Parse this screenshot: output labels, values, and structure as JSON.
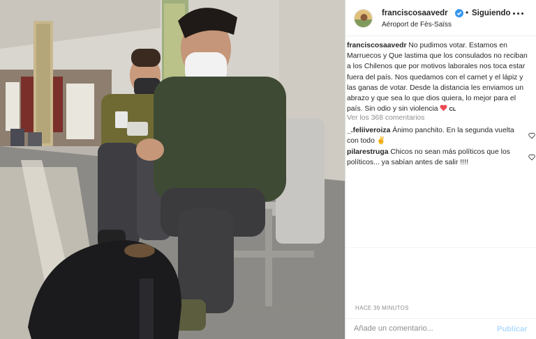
{
  "post": {
    "username": "franciscosaavedr",
    "follow_status": "Siguiendo",
    "separator": "•",
    "location": "Aéroport de Fès-Saïss"
  },
  "caption": {
    "username": "franciscosaavedr",
    "text": "No pudimos votar. Estamos en Marruecos y Que lastima que los consulados no reciban a los Chilenos que por motivos laborales nos toca estar fuera del país. Nos quedamos con el carnet y el lápiz y las ganas de votar. Desde la distancia les enviamos un abrazo y que sea lo que dios quiera, lo mejor para el país. Sin odio y sin violencia",
    "flag_text": "CL"
  },
  "view_comments": "Ver los 368 comentarios",
  "comments": [
    {
      "username": "_.feliiveroiza",
      "text": "Ánimo panchito. En la segunda vuelta con todo",
      "emoji": "✌"
    },
    {
      "username": "pilarestruga",
      "text": "Chicos no sean más políticos que los políticos... ya sabían antes de salir !!!!",
      "emoji": ""
    }
  ],
  "timestamp": "HACE 39 MINUTOS",
  "add_comment_placeholder": "Añade un comentario...",
  "publish_label": "Publicar",
  "colors": {
    "verified_blue": "#3897f0",
    "heart_red": "#ed4956",
    "publish_disabled": "#b3dbff",
    "muted_text": "#8e8e8e"
  }
}
